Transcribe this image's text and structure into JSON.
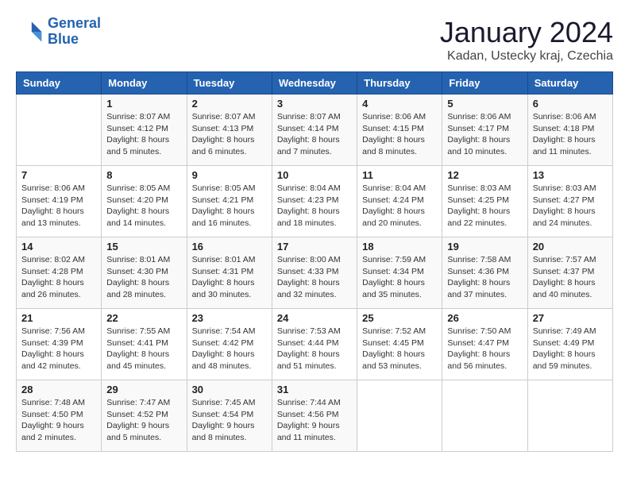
{
  "header": {
    "logo_line1": "General",
    "logo_line2": "Blue",
    "title": "January 2024",
    "subtitle": "Kadan, Ustecky kraj, Czechia"
  },
  "weekdays": [
    "Sunday",
    "Monday",
    "Tuesday",
    "Wednesday",
    "Thursday",
    "Friday",
    "Saturday"
  ],
  "weeks": [
    [
      {
        "day": "",
        "info": ""
      },
      {
        "day": "1",
        "info": "Sunrise: 8:07 AM\nSunset: 4:12 PM\nDaylight: 8 hours\nand 5 minutes."
      },
      {
        "day": "2",
        "info": "Sunrise: 8:07 AM\nSunset: 4:13 PM\nDaylight: 8 hours\nand 6 minutes."
      },
      {
        "day": "3",
        "info": "Sunrise: 8:07 AM\nSunset: 4:14 PM\nDaylight: 8 hours\nand 7 minutes."
      },
      {
        "day": "4",
        "info": "Sunrise: 8:06 AM\nSunset: 4:15 PM\nDaylight: 8 hours\nand 8 minutes."
      },
      {
        "day": "5",
        "info": "Sunrise: 8:06 AM\nSunset: 4:17 PM\nDaylight: 8 hours\nand 10 minutes."
      },
      {
        "day": "6",
        "info": "Sunrise: 8:06 AM\nSunset: 4:18 PM\nDaylight: 8 hours\nand 11 minutes."
      }
    ],
    [
      {
        "day": "7",
        "info": "Sunrise: 8:06 AM\nSunset: 4:19 PM\nDaylight: 8 hours\nand 13 minutes."
      },
      {
        "day": "8",
        "info": "Sunrise: 8:05 AM\nSunset: 4:20 PM\nDaylight: 8 hours\nand 14 minutes."
      },
      {
        "day": "9",
        "info": "Sunrise: 8:05 AM\nSunset: 4:21 PM\nDaylight: 8 hours\nand 16 minutes."
      },
      {
        "day": "10",
        "info": "Sunrise: 8:04 AM\nSunset: 4:23 PM\nDaylight: 8 hours\nand 18 minutes."
      },
      {
        "day": "11",
        "info": "Sunrise: 8:04 AM\nSunset: 4:24 PM\nDaylight: 8 hours\nand 20 minutes."
      },
      {
        "day": "12",
        "info": "Sunrise: 8:03 AM\nSunset: 4:25 PM\nDaylight: 8 hours\nand 22 minutes."
      },
      {
        "day": "13",
        "info": "Sunrise: 8:03 AM\nSunset: 4:27 PM\nDaylight: 8 hours\nand 24 minutes."
      }
    ],
    [
      {
        "day": "14",
        "info": "Sunrise: 8:02 AM\nSunset: 4:28 PM\nDaylight: 8 hours\nand 26 minutes."
      },
      {
        "day": "15",
        "info": "Sunrise: 8:01 AM\nSunset: 4:30 PM\nDaylight: 8 hours\nand 28 minutes."
      },
      {
        "day": "16",
        "info": "Sunrise: 8:01 AM\nSunset: 4:31 PM\nDaylight: 8 hours\nand 30 minutes."
      },
      {
        "day": "17",
        "info": "Sunrise: 8:00 AM\nSunset: 4:33 PM\nDaylight: 8 hours\nand 32 minutes."
      },
      {
        "day": "18",
        "info": "Sunrise: 7:59 AM\nSunset: 4:34 PM\nDaylight: 8 hours\nand 35 minutes."
      },
      {
        "day": "19",
        "info": "Sunrise: 7:58 AM\nSunset: 4:36 PM\nDaylight: 8 hours\nand 37 minutes."
      },
      {
        "day": "20",
        "info": "Sunrise: 7:57 AM\nSunset: 4:37 PM\nDaylight: 8 hours\nand 40 minutes."
      }
    ],
    [
      {
        "day": "21",
        "info": "Sunrise: 7:56 AM\nSunset: 4:39 PM\nDaylight: 8 hours\nand 42 minutes."
      },
      {
        "day": "22",
        "info": "Sunrise: 7:55 AM\nSunset: 4:41 PM\nDaylight: 8 hours\nand 45 minutes."
      },
      {
        "day": "23",
        "info": "Sunrise: 7:54 AM\nSunset: 4:42 PM\nDaylight: 8 hours\nand 48 minutes."
      },
      {
        "day": "24",
        "info": "Sunrise: 7:53 AM\nSunset: 4:44 PM\nDaylight: 8 hours\nand 51 minutes."
      },
      {
        "day": "25",
        "info": "Sunrise: 7:52 AM\nSunset: 4:45 PM\nDaylight: 8 hours\nand 53 minutes."
      },
      {
        "day": "26",
        "info": "Sunrise: 7:50 AM\nSunset: 4:47 PM\nDaylight: 8 hours\nand 56 minutes."
      },
      {
        "day": "27",
        "info": "Sunrise: 7:49 AM\nSunset: 4:49 PM\nDaylight: 8 hours\nand 59 minutes."
      }
    ],
    [
      {
        "day": "28",
        "info": "Sunrise: 7:48 AM\nSunset: 4:50 PM\nDaylight: 9 hours\nand 2 minutes."
      },
      {
        "day": "29",
        "info": "Sunrise: 7:47 AM\nSunset: 4:52 PM\nDaylight: 9 hours\nand 5 minutes."
      },
      {
        "day": "30",
        "info": "Sunrise: 7:45 AM\nSunset: 4:54 PM\nDaylight: 9 hours\nand 8 minutes."
      },
      {
        "day": "31",
        "info": "Sunrise: 7:44 AM\nSunset: 4:56 PM\nDaylight: 9 hours\nand 11 minutes."
      },
      {
        "day": "",
        "info": ""
      },
      {
        "day": "",
        "info": ""
      },
      {
        "day": "",
        "info": ""
      }
    ]
  ]
}
